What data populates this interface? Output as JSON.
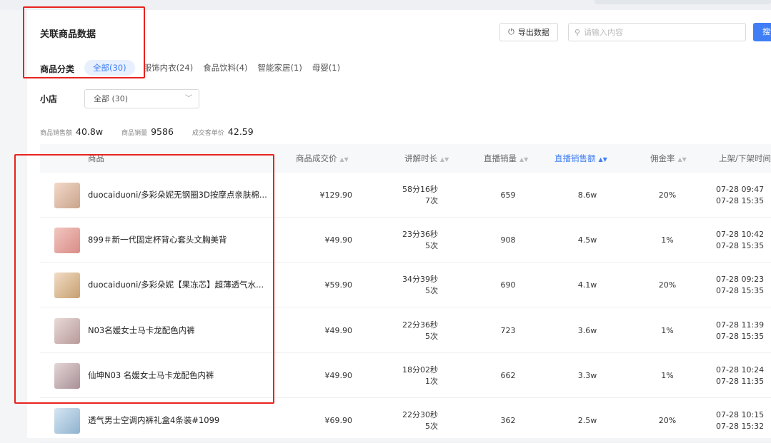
{
  "page": {
    "title": "关联商品数据",
    "export_label": "导出数据",
    "search_placeholder": "请输入内容",
    "search_button": "搜索"
  },
  "category": {
    "label": "商品分类",
    "tabs": [
      "全部(30)",
      "服饰内衣(24)",
      "食品饮料(4)",
      "智能家居(1)",
      "母婴(1)"
    ],
    "active_index": 0
  },
  "shop": {
    "label": "小店",
    "selected": "全部 (30)"
  },
  "stats": [
    {
      "label": "商品销售额",
      "value": "40.8w"
    },
    {
      "label": "商品销量",
      "value": "9586"
    },
    {
      "label": "成交客单价",
      "value": "42.59"
    }
  ],
  "table": {
    "columns": [
      "商品",
      "商品成交价",
      "讲解时长",
      "直播销量",
      "直播销售额",
      "佣金率",
      "上架/下架时间"
    ],
    "sorted_column": "直播销售额",
    "rows": [
      {
        "name": "duocaiduoni/多彩朵妮无钢圈3D按摩点亲肤棉...",
        "price": "¥129.90",
        "duration": "58分16秒",
        "count": "7次",
        "qty": "659",
        "gmv": "8.6w",
        "commission": "20%",
        "on": "07-28 09:47",
        "off": "07-28 15:35"
      },
      {
        "name": "899＃新一代固定杯背心套头文胸美背",
        "price": "¥49.90",
        "duration": "23分36秒",
        "count": "5次",
        "qty": "908",
        "gmv": "4.5w",
        "commission": "1%",
        "on": "07-28 10:42",
        "off": "07-28 15:35"
      },
      {
        "name": "duocaiduoni/多彩朵妮【果冻芯】超薄透气水...",
        "price": "¥59.90",
        "duration": "34分39秒",
        "count": "5次",
        "qty": "690",
        "gmv": "4.1w",
        "commission": "20%",
        "on": "07-28 09:23",
        "off": "07-28 15:35"
      },
      {
        "name": "N03名媛女士马卡龙配色内裤",
        "price": "¥49.90",
        "duration": "22分36秒",
        "count": "5次",
        "qty": "723",
        "gmv": "3.6w",
        "commission": "1%",
        "on": "07-28 11:39",
        "off": "07-28 15:35"
      },
      {
        "name": "仙坤N03 名媛女士马卡龙配色内裤",
        "price": "¥49.90",
        "duration": "18分02秒",
        "count": "1次",
        "qty": "662",
        "gmv": "3.3w",
        "commission": "1%",
        "on": "07-28 10:24",
        "off": "07-28 11:35"
      },
      {
        "name": "透气男士空调内裤礼盒4条装#1099",
        "price": "¥69.90",
        "duration": "22分30秒",
        "count": "5次",
        "qty": "362",
        "gmv": "2.5w",
        "commission": "20%",
        "on": "07-28 10:15",
        "off": "07-28 15:32"
      }
    ]
  },
  "colors": {
    "accent": "#3f7ef5",
    "highlight": "#e8231f"
  }
}
